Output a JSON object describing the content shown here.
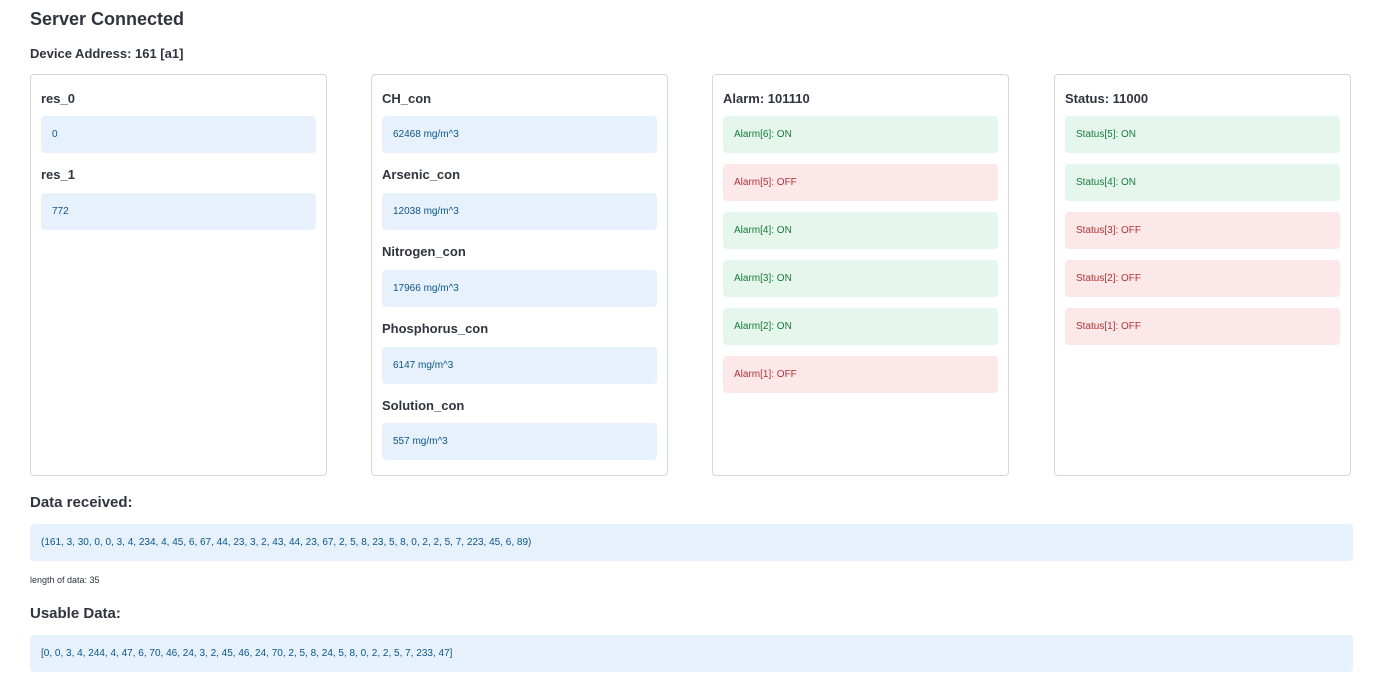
{
  "page_title": "Server Connected",
  "device_address": "Device Address: 161 [a1]",
  "res_card": {
    "items": [
      {
        "label": "res_0",
        "value": "0"
      },
      {
        "label": "res_1",
        "value": "772"
      }
    ]
  },
  "con_card": {
    "items": [
      {
        "label": "CH_con",
        "value": "62468 mg/m^3"
      },
      {
        "label": "Arsenic_con",
        "value": "12038 mg/m^3"
      },
      {
        "label": "Nitrogen_con",
        "value": "17966 mg/m^3"
      },
      {
        "label": "Phosphorus_con",
        "value": "6147 mg/m^3"
      },
      {
        "label": "Solution_con",
        "value": "557 mg/m^3"
      }
    ]
  },
  "alarm_card": {
    "title": "Alarm: 101110",
    "items": [
      {
        "text": "Alarm[6]: ON",
        "state": "on"
      },
      {
        "text": "Alarm[5]: OFF",
        "state": "off"
      },
      {
        "text": "Alarm[4]: ON",
        "state": "on"
      },
      {
        "text": "Alarm[3]: ON",
        "state": "on"
      },
      {
        "text": "Alarm[2]: ON",
        "state": "on"
      },
      {
        "text": "Alarm[1]: OFF",
        "state": "off"
      }
    ]
  },
  "status_card": {
    "title": "Status: 11000",
    "items": [
      {
        "text": "Status[5]: ON",
        "state": "on"
      },
      {
        "text": "Status[4]: ON",
        "state": "on"
      },
      {
        "text": "Status[3]: OFF",
        "state": "off"
      },
      {
        "text": "Status[2]: OFF",
        "state": "off"
      },
      {
        "text": "Status[1]: OFF",
        "state": "off"
      }
    ]
  },
  "data_received": {
    "heading": "Data received:",
    "value": "(161, 3, 30, 0, 0, 3, 4, 234, 4, 45, 6, 67, 44, 23, 3, 2, 43, 44, 23, 67, 2, 5, 8, 23, 5, 8, 0, 2, 2, 5, 7, 223, 45, 6, 89)",
    "length_text": "length of data: 35"
  },
  "usable_data": {
    "heading": "Usable Data:",
    "value": "[0, 0, 3, 4, 244, 4, 47, 6, 70, 46, 24, 3, 2, 45, 46, 24, 70, 2, 5, 8, 24, 5, 8, 0, 2, 2, 5, 7, 233, 47]"
  },
  "colors": {
    "info_bg": "#e6f1fc",
    "info_text": "#0c5688",
    "on_bg": "#e5f6ec",
    "on_text": "#187a3c",
    "off_bg": "#fce8e8",
    "off_text": "#b13339"
  }
}
